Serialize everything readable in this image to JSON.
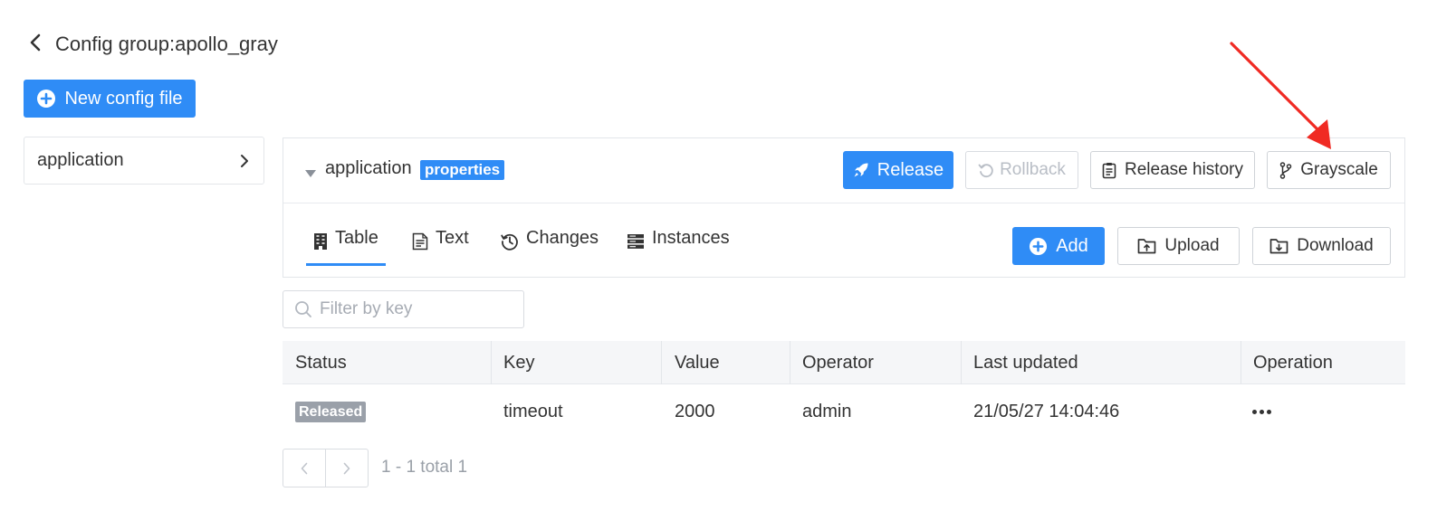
{
  "header": {
    "title": "Config group:apollo_gray"
  },
  "toolbar": {
    "new_config_label": "New config file"
  },
  "sidebar": {
    "files": [
      {
        "label": "application"
      }
    ]
  },
  "namespace": {
    "name": "application",
    "format_badge": "properties",
    "actions": {
      "release": "Release",
      "rollback": "Rollback",
      "history": "Release history",
      "grayscale": "Grayscale"
    }
  },
  "tabs": [
    {
      "label": "Table",
      "active": true
    },
    {
      "label": "Text",
      "active": false
    },
    {
      "label": "Changes",
      "active": false
    },
    {
      "label": "Instances",
      "active": false
    }
  ],
  "table_actions": {
    "add": "Add",
    "upload": "Upload",
    "download": "Download"
  },
  "filter": {
    "placeholder": "Filter by key",
    "value": ""
  },
  "table": {
    "columns": [
      "Status",
      "Key",
      "Value",
      "Operator",
      "Last updated",
      "Operation"
    ],
    "rows": [
      {
        "status": "Released",
        "key": "timeout",
        "value": "2000",
        "operator": "admin",
        "last_updated": "21/05/27 14:04:46"
      }
    ]
  },
  "pagination": {
    "info": "1 - 1 total 1"
  },
  "colors": {
    "primary": "#2f8cf6",
    "status_released": "#9aa0a9",
    "annotation_arrow": "#f02a23"
  },
  "icons": {
    "back": "chevron-left-icon",
    "new_config": "plus-circle-icon",
    "file_chevron": "chevron-right-icon",
    "namespace_toggle": "caret-down-icon",
    "release": "rocket-icon",
    "rollback": "rollback-icon",
    "history": "clipboard-icon",
    "grayscale": "branch-icon",
    "tab_table": "table-icon",
    "tab_text": "document-icon",
    "tab_changes": "history-clock-icon",
    "tab_instances": "server-icon",
    "add": "plus-circle-icon",
    "upload": "folder-upload-icon",
    "download": "folder-download-icon",
    "filter": "search-icon",
    "operation": "more-icon"
  }
}
